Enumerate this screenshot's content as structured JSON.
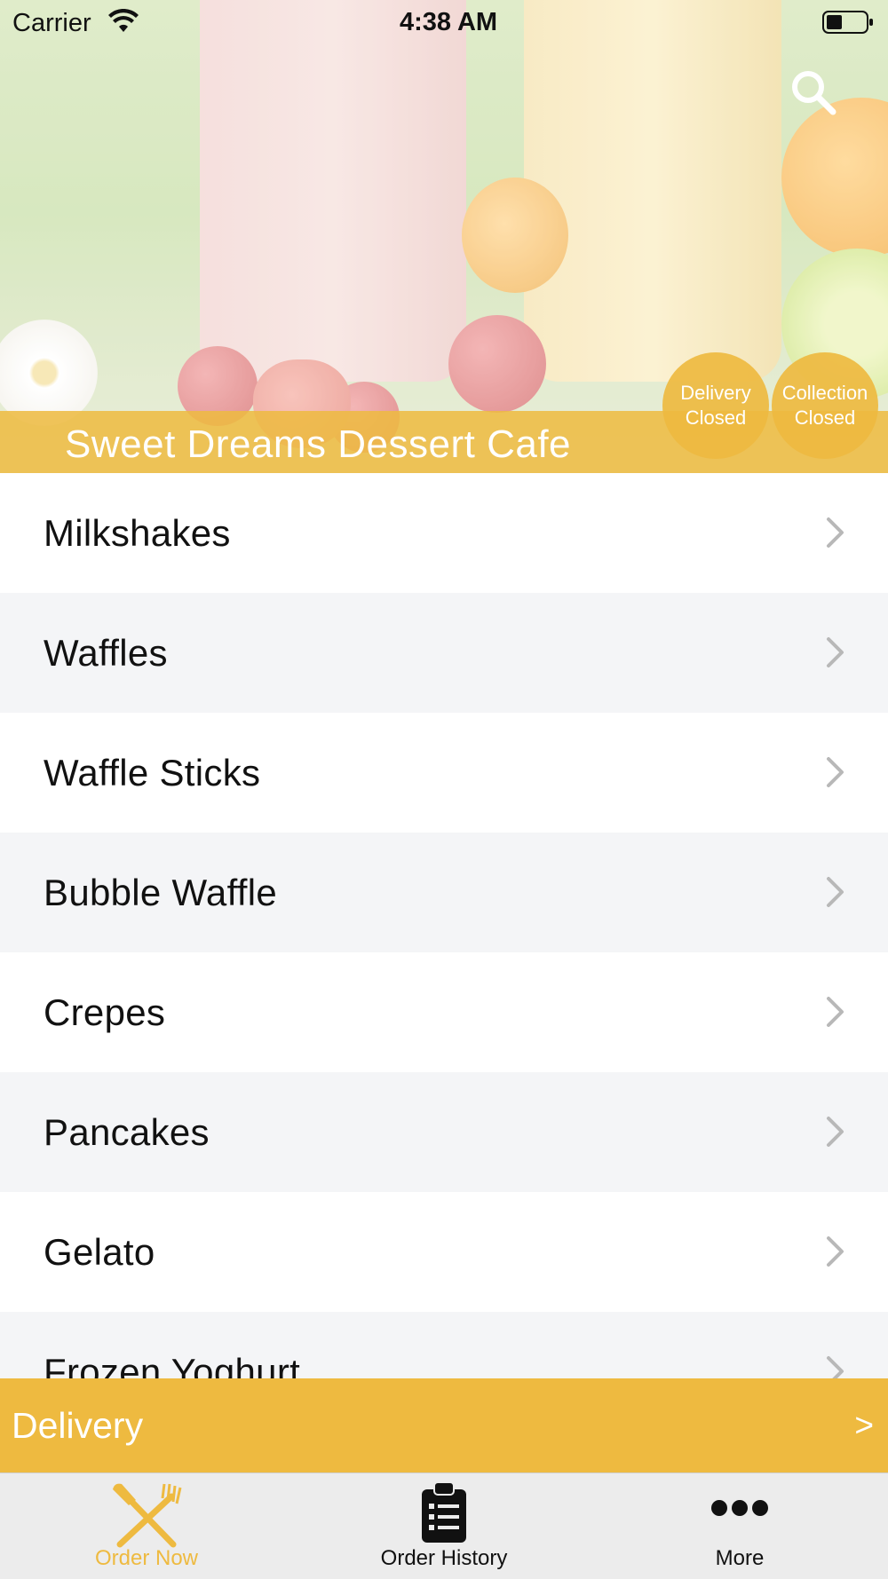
{
  "status_bar": {
    "carrier": "Carrier",
    "time": "4:38 AM"
  },
  "header": {
    "cafe_name": "Sweet Dreams Dessert Cafe",
    "search_icon": "search-icon",
    "badges": {
      "delivery": {
        "line1": "Delivery",
        "line2": "Closed"
      },
      "collection": {
        "line1": "Collection",
        "line2": "Closed"
      }
    }
  },
  "menu": {
    "items": [
      {
        "label": "Milkshakes"
      },
      {
        "label": "Waffles"
      },
      {
        "label": "Waffle Sticks"
      },
      {
        "label": "Bubble Waffle"
      },
      {
        "label": "Crepes"
      },
      {
        "label": "Pancakes"
      },
      {
        "label": "Gelato"
      },
      {
        "label": "Frozen Yoghurt"
      }
    ]
  },
  "delivery_bar": {
    "label": "Delivery",
    "arrow": ">"
  },
  "tab_bar": {
    "tabs": [
      {
        "label": "Order Now",
        "icon": "fork-knife-icon",
        "active": true
      },
      {
        "label": "Order History",
        "icon": "clipboard-icon",
        "active": false
      },
      {
        "label": "More",
        "icon": "more-dots-icon",
        "active": false
      }
    ]
  },
  "colors": {
    "accent": "#eeba40",
    "row_alt": "#f4f5f7",
    "tab_bar_bg": "#ececec"
  }
}
